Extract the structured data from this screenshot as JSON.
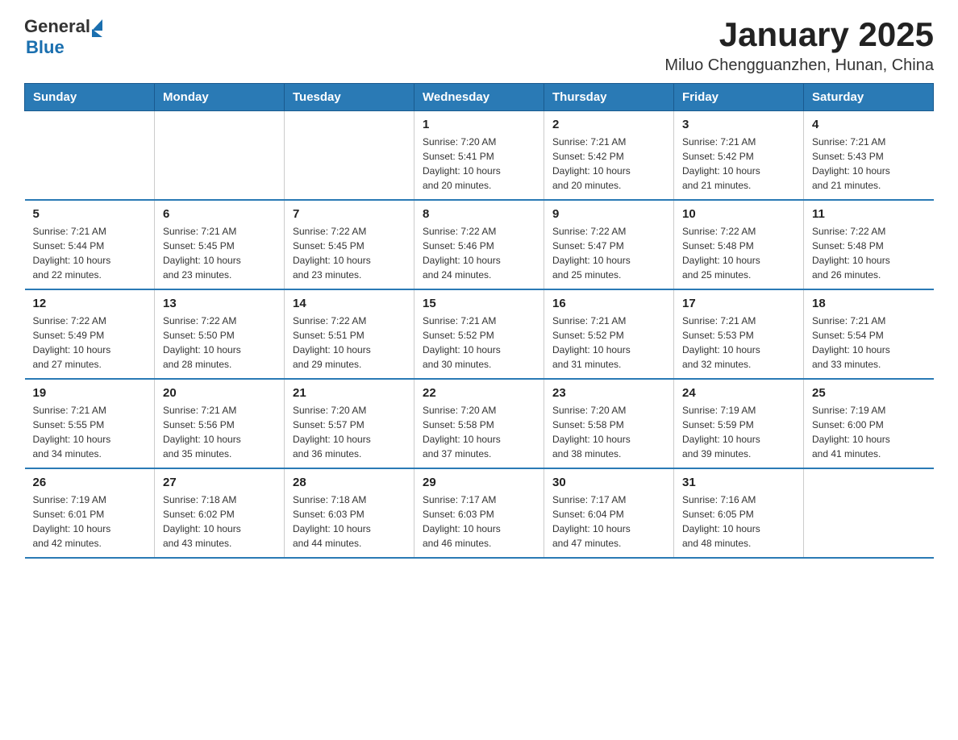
{
  "header": {
    "logo_general": "General",
    "logo_blue": "Blue",
    "title": "January 2025",
    "subtitle": "Miluo Chengguanzhen, Hunan, China"
  },
  "days_of_week": [
    "Sunday",
    "Monday",
    "Tuesday",
    "Wednesday",
    "Thursday",
    "Friday",
    "Saturday"
  ],
  "weeks": [
    [
      {
        "day": "",
        "info": ""
      },
      {
        "day": "",
        "info": ""
      },
      {
        "day": "",
        "info": ""
      },
      {
        "day": "1",
        "info": "Sunrise: 7:20 AM\nSunset: 5:41 PM\nDaylight: 10 hours\nand 20 minutes."
      },
      {
        "day": "2",
        "info": "Sunrise: 7:21 AM\nSunset: 5:42 PM\nDaylight: 10 hours\nand 20 minutes."
      },
      {
        "day": "3",
        "info": "Sunrise: 7:21 AM\nSunset: 5:42 PM\nDaylight: 10 hours\nand 21 minutes."
      },
      {
        "day": "4",
        "info": "Sunrise: 7:21 AM\nSunset: 5:43 PM\nDaylight: 10 hours\nand 21 minutes."
      }
    ],
    [
      {
        "day": "5",
        "info": "Sunrise: 7:21 AM\nSunset: 5:44 PM\nDaylight: 10 hours\nand 22 minutes."
      },
      {
        "day": "6",
        "info": "Sunrise: 7:21 AM\nSunset: 5:45 PM\nDaylight: 10 hours\nand 23 minutes."
      },
      {
        "day": "7",
        "info": "Sunrise: 7:22 AM\nSunset: 5:45 PM\nDaylight: 10 hours\nand 23 minutes."
      },
      {
        "day": "8",
        "info": "Sunrise: 7:22 AM\nSunset: 5:46 PM\nDaylight: 10 hours\nand 24 minutes."
      },
      {
        "day": "9",
        "info": "Sunrise: 7:22 AM\nSunset: 5:47 PM\nDaylight: 10 hours\nand 25 minutes."
      },
      {
        "day": "10",
        "info": "Sunrise: 7:22 AM\nSunset: 5:48 PM\nDaylight: 10 hours\nand 25 minutes."
      },
      {
        "day": "11",
        "info": "Sunrise: 7:22 AM\nSunset: 5:48 PM\nDaylight: 10 hours\nand 26 minutes."
      }
    ],
    [
      {
        "day": "12",
        "info": "Sunrise: 7:22 AM\nSunset: 5:49 PM\nDaylight: 10 hours\nand 27 minutes."
      },
      {
        "day": "13",
        "info": "Sunrise: 7:22 AM\nSunset: 5:50 PM\nDaylight: 10 hours\nand 28 minutes."
      },
      {
        "day": "14",
        "info": "Sunrise: 7:22 AM\nSunset: 5:51 PM\nDaylight: 10 hours\nand 29 minutes."
      },
      {
        "day": "15",
        "info": "Sunrise: 7:21 AM\nSunset: 5:52 PM\nDaylight: 10 hours\nand 30 minutes."
      },
      {
        "day": "16",
        "info": "Sunrise: 7:21 AM\nSunset: 5:52 PM\nDaylight: 10 hours\nand 31 minutes."
      },
      {
        "day": "17",
        "info": "Sunrise: 7:21 AM\nSunset: 5:53 PM\nDaylight: 10 hours\nand 32 minutes."
      },
      {
        "day": "18",
        "info": "Sunrise: 7:21 AM\nSunset: 5:54 PM\nDaylight: 10 hours\nand 33 minutes."
      }
    ],
    [
      {
        "day": "19",
        "info": "Sunrise: 7:21 AM\nSunset: 5:55 PM\nDaylight: 10 hours\nand 34 minutes."
      },
      {
        "day": "20",
        "info": "Sunrise: 7:21 AM\nSunset: 5:56 PM\nDaylight: 10 hours\nand 35 minutes."
      },
      {
        "day": "21",
        "info": "Sunrise: 7:20 AM\nSunset: 5:57 PM\nDaylight: 10 hours\nand 36 minutes."
      },
      {
        "day": "22",
        "info": "Sunrise: 7:20 AM\nSunset: 5:58 PM\nDaylight: 10 hours\nand 37 minutes."
      },
      {
        "day": "23",
        "info": "Sunrise: 7:20 AM\nSunset: 5:58 PM\nDaylight: 10 hours\nand 38 minutes."
      },
      {
        "day": "24",
        "info": "Sunrise: 7:19 AM\nSunset: 5:59 PM\nDaylight: 10 hours\nand 39 minutes."
      },
      {
        "day": "25",
        "info": "Sunrise: 7:19 AM\nSunset: 6:00 PM\nDaylight: 10 hours\nand 41 minutes."
      }
    ],
    [
      {
        "day": "26",
        "info": "Sunrise: 7:19 AM\nSunset: 6:01 PM\nDaylight: 10 hours\nand 42 minutes."
      },
      {
        "day": "27",
        "info": "Sunrise: 7:18 AM\nSunset: 6:02 PM\nDaylight: 10 hours\nand 43 minutes."
      },
      {
        "day": "28",
        "info": "Sunrise: 7:18 AM\nSunset: 6:03 PM\nDaylight: 10 hours\nand 44 minutes."
      },
      {
        "day": "29",
        "info": "Sunrise: 7:17 AM\nSunset: 6:03 PM\nDaylight: 10 hours\nand 46 minutes."
      },
      {
        "day": "30",
        "info": "Sunrise: 7:17 AM\nSunset: 6:04 PM\nDaylight: 10 hours\nand 47 minutes."
      },
      {
        "day": "31",
        "info": "Sunrise: 7:16 AM\nSunset: 6:05 PM\nDaylight: 10 hours\nand 48 minutes."
      },
      {
        "day": "",
        "info": ""
      }
    ]
  ]
}
